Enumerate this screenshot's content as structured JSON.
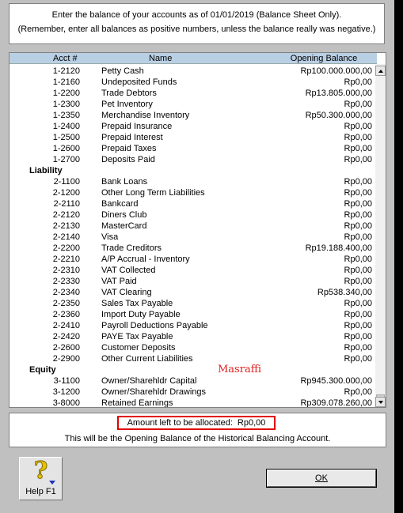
{
  "instructions": {
    "line1": "Enter the balance of your accounts as of 01/01/2019 (Balance Sheet Only).",
    "line2": "(Remember, enter all balances as positive numbers, unless the balance really was negative.)"
  },
  "columns": {
    "acct": "Acct #",
    "name": "Name",
    "balance": "Opening Balance"
  },
  "rows": [
    {
      "acct": "1-2120",
      "name": "Petty Cash",
      "balance": "Rp100.000.000,00"
    },
    {
      "acct": "1-2160",
      "name": "Undeposited Funds",
      "balance": "Rp0,00"
    },
    {
      "acct": "1-2200",
      "name": "Trade Debtors",
      "balance": "Rp13.805.000,00"
    },
    {
      "acct": "1-2300",
      "name": "Pet Inventory",
      "balance": "Rp0,00"
    },
    {
      "acct": "1-2350",
      "name": "Merchandise Inventory",
      "balance": "Rp50.300.000,00"
    },
    {
      "acct": "1-2400",
      "name": "Prepaid Insurance",
      "balance": "Rp0,00"
    },
    {
      "acct": "1-2500",
      "name": "Prepaid Interest",
      "balance": "Rp0,00"
    },
    {
      "acct": "1-2600",
      "name": "Prepaid Taxes",
      "balance": "Rp0,00"
    },
    {
      "acct": "1-2700",
      "name": "Deposits Paid",
      "balance": "Rp0,00"
    },
    {
      "group": "Liability"
    },
    {
      "acct": "2-1100",
      "name": "Bank Loans",
      "balance": "Rp0,00"
    },
    {
      "acct": "2-1200",
      "name": "Other Long Term Liabilities",
      "balance": "Rp0,00"
    },
    {
      "acct": "2-2110",
      "name": "Bankcard",
      "balance": "Rp0,00"
    },
    {
      "acct": "2-2120",
      "name": "Diners Club",
      "balance": "Rp0,00"
    },
    {
      "acct": "2-2130",
      "name": "MasterCard",
      "balance": "Rp0,00"
    },
    {
      "acct": "2-2140",
      "name": "Visa",
      "balance": "Rp0,00"
    },
    {
      "acct": "2-2200",
      "name": "Trade Creditors",
      "balance": "Rp19.188.400,00"
    },
    {
      "acct": "2-2210",
      "name": "A/P Accrual - Inventory",
      "balance": "Rp0,00"
    },
    {
      "acct": "2-2310",
      "name": "VAT Collected",
      "balance": "Rp0,00"
    },
    {
      "acct": "2-2330",
      "name": "VAT Paid",
      "balance": "Rp0,00"
    },
    {
      "acct": "2-2340",
      "name": "VAT Clearing",
      "balance": "Rp538.340,00"
    },
    {
      "acct": "2-2350",
      "name": "Sales Tax Payable",
      "balance": "Rp0,00"
    },
    {
      "acct": "2-2360",
      "name": "Import Duty Payable",
      "balance": "Rp0,00"
    },
    {
      "acct": "2-2410",
      "name": "Payroll Deductions Payable",
      "balance": "Rp0,00"
    },
    {
      "acct": "2-2420",
      "name": "PAYE Tax Payable",
      "balance": "Rp0,00"
    },
    {
      "acct": "2-2600",
      "name": "Customer Deposits",
      "balance": "Rp0,00"
    },
    {
      "acct": "2-2900",
      "name": "Other Current Liabilities",
      "balance": "Rp0,00"
    },
    {
      "group": "Equity"
    },
    {
      "acct": "3-1100",
      "name": "Owner/Sharehldr Capital",
      "balance": "Rp945.300.000,00"
    },
    {
      "acct": "3-1200",
      "name": "Owner/Sharehldr Drawings",
      "balance": "Rp0,00"
    },
    {
      "acct": "3-8000",
      "name": "Retained Earnings",
      "balance": "Rp309.078.260,00"
    }
  ],
  "watermark": "Masraffi",
  "allocation": {
    "label": "Amount left to be allocated:",
    "value": "Rp0,00",
    "note": "This will be the Opening Balance of the Historical Balancing Account."
  },
  "help_button": {
    "label": "Help F1",
    "icon": "question-mark-icon"
  },
  "ok_button": {
    "label": "OK"
  },
  "colors": {
    "header_bg": "#b9cfe4",
    "highlight": "#e00000",
    "dialog_bg": "#c0c0c0"
  }
}
